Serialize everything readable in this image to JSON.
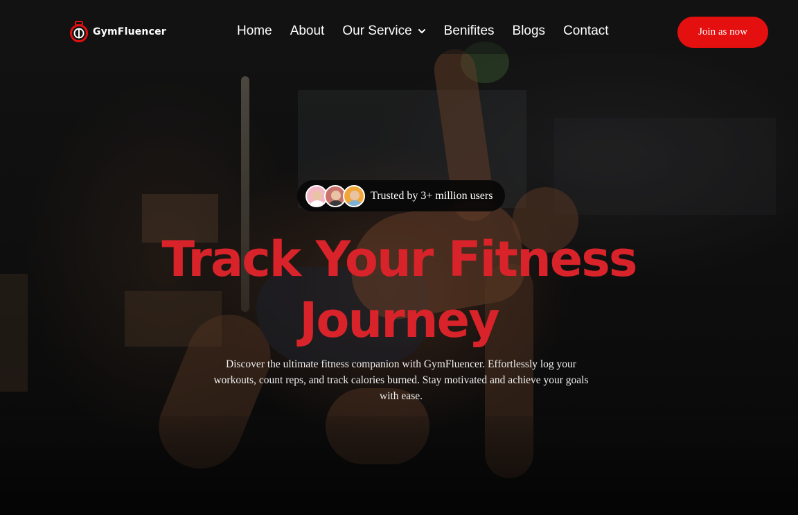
{
  "brand": {
    "name": "GymFluencer",
    "accent_color": "#e40f0f",
    "title_color": "#d8232a",
    "logo_icon": "gym-ring-logo-icon"
  },
  "nav": {
    "items": [
      {
        "label": "Home"
      },
      {
        "label": "About"
      },
      {
        "label": "Our Service",
        "icon": "chevron-down-icon"
      },
      {
        "label": "Benifites"
      },
      {
        "label": "Blogs"
      },
      {
        "label": "Contact"
      }
    ],
    "cta_label": "Join as now"
  },
  "hero": {
    "trust_text": "Trusted by 3+ million users",
    "title_line1": "Track Your Fitness",
    "title_line2": "Journey",
    "description": "Discover the ultimate fitness companion with GymFluencer. Effortlessly log your workouts, count reps, and track calories burned. Stay motivated and achieve your goals with ease."
  }
}
